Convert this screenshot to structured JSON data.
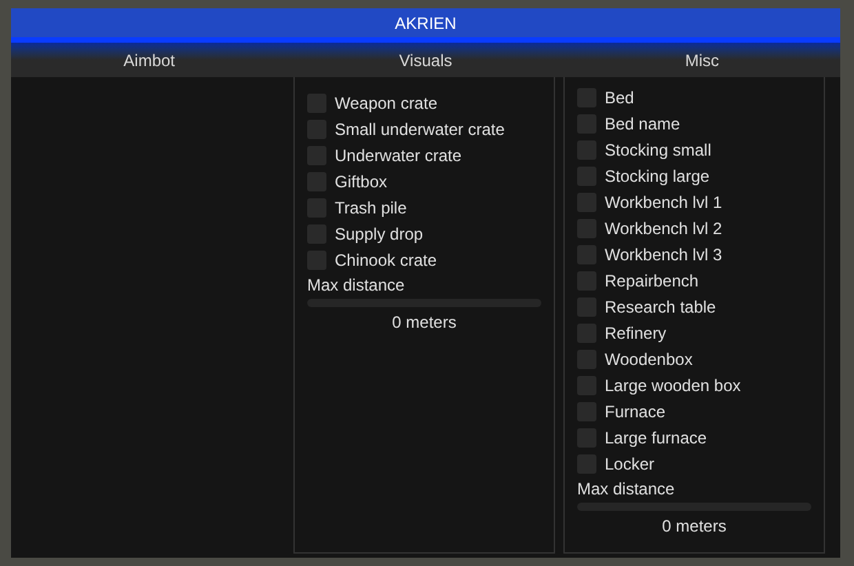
{
  "window": {
    "title": "AKRIEN"
  },
  "tabs": [
    {
      "label": "Aimbot",
      "selected": false
    },
    {
      "label": "Visuals",
      "selected": false
    },
    {
      "label": "Misc",
      "selected": false
    }
  ],
  "panels": [
    {
      "items": [
        {
          "label": "Weapon crate",
          "checked": false
        },
        {
          "label": "Small underwater crate",
          "checked": false
        },
        {
          "label": "Underwater crate",
          "checked": false
        },
        {
          "label": "Giftbox",
          "checked": false
        },
        {
          "label": "Trash pile",
          "checked": false
        },
        {
          "label": "Supply drop",
          "checked": false
        },
        {
          "label": "Chinook crate",
          "checked": false
        }
      ],
      "slider": {
        "label": "Max distance",
        "reading": "0 meters"
      }
    },
    {
      "items": [
        {
          "label": "Bed",
          "checked": false
        },
        {
          "label": "Bed name",
          "checked": false
        },
        {
          "label": "Stocking small",
          "checked": false
        },
        {
          "label": "Stocking large",
          "checked": false
        },
        {
          "label": "Workbench lvl 1",
          "checked": false
        },
        {
          "label": "Workbench lvl 2",
          "checked": false
        },
        {
          "label": "Workbench lvl 3",
          "checked": false
        },
        {
          "label": "Repairbench",
          "checked": false
        },
        {
          "label": "Research table",
          "checked": false
        },
        {
          "label": "Refinery",
          "checked": false
        },
        {
          "label": "Woodenbox",
          "checked": false
        },
        {
          "label": "Large wooden box",
          "checked": false
        },
        {
          "label": "Furnace",
          "checked": false
        },
        {
          "label": "Large furnace",
          "checked": false
        },
        {
          "label": "Locker",
          "checked": false
        }
      ],
      "slider": {
        "label": "Max distance",
        "reading": "0 meters"
      }
    }
  ]
}
